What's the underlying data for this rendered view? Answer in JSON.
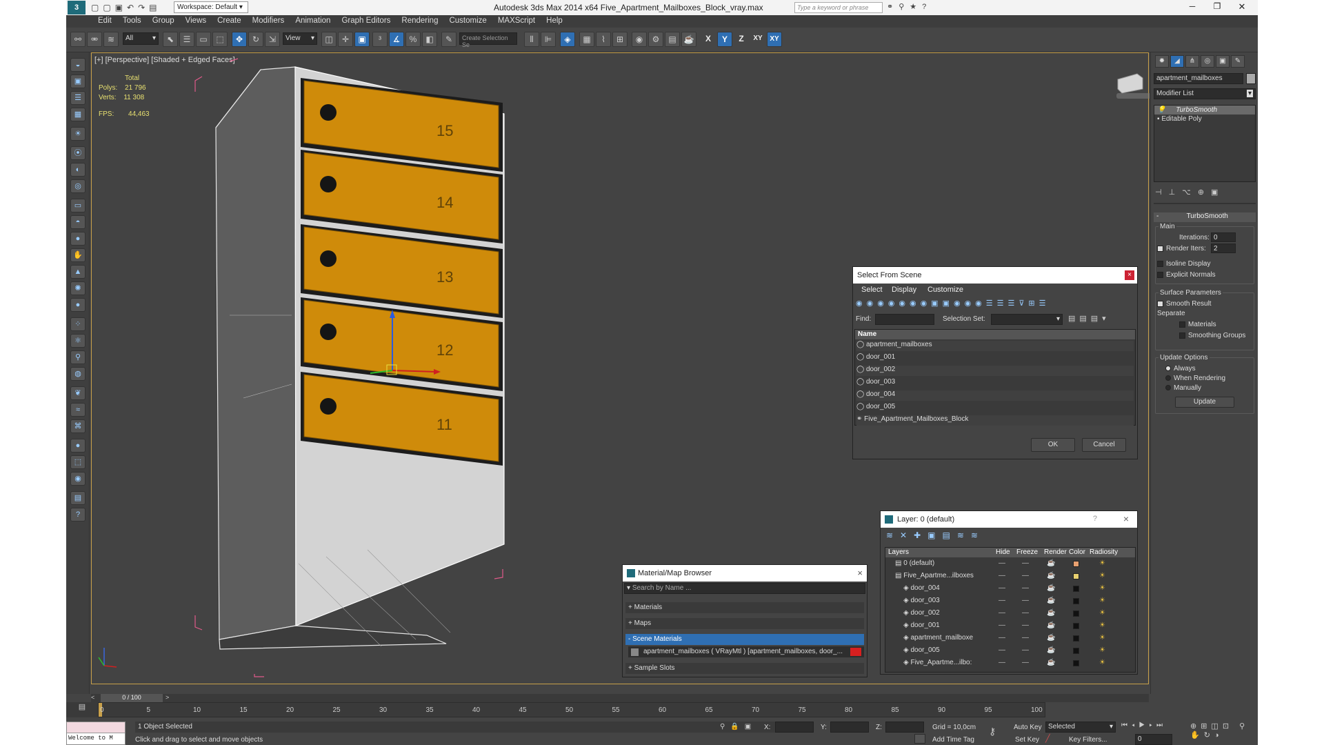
{
  "window": {
    "title": "Autodesk 3ds Max  2014 x64      Five_Apartment_Mailboxes_Block_vray.max",
    "workspace": "Workspace: Default",
    "search_placeholder": "Type a keyword or phrase"
  },
  "menu": [
    "Edit",
    "Tools",
    "Group",
    "Views",
    "Create",
    "Modifiers",
    "Animation",
    "Graph Editors",
    "Rendering",
    "Customize",
    "MAXScript",
    "Help"
  ],
  "toolbar": {
    "filter_value": "All",
    "refcoord_value": "View",
    "selection_set_placeholder": "Create Selection Se",
    "axes": [
      "X",
      "Y",
      "Z",
      "XY",
      "XY"
    ]
  },
  "viewport": {
    "label": "[+] [Perspective] [Shaded + Edged Faces]",
    "stats": {
      "total_label": "Total",
      "polys_label": "Polys:",
      "polys": "21 796",
      "verts_label": "Verts:",
      "verts": "11 308",
      "fps_label": "FPS:",
      "fps": "44,463"
    },
    "drawer_labels": [
      "15",
      "14",
      "13",
      "12",
      "11"
    ],
    "colors": {
      "drawer": "#cf8b0a",
      "drawer_edge": "#1c1c1c",
      "frame": "#dcdcdc",
      "selection": "#e05a8a"
    }
  },
  "command_panel": {
    "object_name": "apartment_mailboxes",
    "modifier_list_label": "Modifier List",
    "stack": [
      "TurboSmooth",
      "Editable Poly"
    ],
    "rollout_title": "TurboSmooth",
    "main_label": "Main",
    "iterations_label": "Iterations:",
    "iterations": "0",
    "render_iters_label": "Render Iters:",
    "render_iters": "2",
    "isoline": "Isoline Display",
    "explicit_normals": "Explicit Normals",
    "surface_params": "Surface Parameters",
    "smooth_result": "Smooth Result",
    "separate": "Separate",
    "materials": "Materials",
    "smoothing_groups": "Smoothing Groups",
    "update_options": "Update Options",
    "always": "Always",
    "when_rendering": "When Rendering",
    "manually": "Manually",
    "update_button": "Update"
  },
  "select_from_scene": {
    "title": "Select From Scene",
    "menu": [
      "Select",
      "Display",
      "Customize"
    ],
    "find_label": "Find:",
    "selection_set_label": "Selection Set:",
    "column_name": "Name",
    "items": [
      "apartment_mailboxes",
      "door_001",
      "door_002",
      "door_003",
      "door_004",
      "door_005",
      "Five_Apartment_Mailboxes_Block"
    ],
    "ok": "OK",
    "cancel": "Cancel"
  },
  "material_browser": {
    "title": "Material/Map Browser",
    "search_placeholder": "Search by Name ...",
    "sections": [
      "+ Materials",
      "+ Maps",
      "- Scene Materials",
      "+ Sample Slots"
    ],
    "scene_material": "apartment_mailboxes  ( VRayMtl ) [apartment_mailboxes, door_..."
  },
  "layer_dialog": {
    "title": "Layer: 0 (default)",
    "help": "?",
    "columns": [
      "Layers",
      "Hide",
      "Freeze",
      "Render",
      "Color",
      "Radiosity"
    ],
    "rows": [
      {
        "name": "0 (default)",
        "indent": 0,
        "color": "#e8a070"
      },
      {
        "name": "Five_Apartme...ilboxes",
        "indent": 0,
        "color": "#e8d070"
      },
      {
        "name": "door_004",
        "indent": 1,
        "color": "#111111"
      },
      {
        "name": "door_003",
        "indent": 1,
        "color": "#111111"
      },
      {
        "name": "door_002",
        "indent": 1,
        "color": "#111111"
      },
      {
        "name": "door_001",
        "indent": 1,
        "color": "#111111"
      },
      {
        "name": "apartment_mailboxe",
        "indent": 1,
        "color": "#111111"
      },
      {
        "name": "door_005",
        "indent": 1,
        "color": "#111111"
      },
      {
        "name": "Five_Apartme...ilbo:",
        "indent": 1,
        "color": "#111111"
      }
    ]
  },
  "timeline": {
    "frame_display": "0 / 100",
    "ticks": [
      "0",
      "5",
      "10",
      "15",
      "20",
      "25",
      "30",
      "35",
      "40",
      "45",
      "50",
      "55",
      "60",
      "65",
      "70",
      "75",
      "80",
      "85",
      "90",
      "95",
      "100"
    ]
  },
  "status": {
    "selection": "1 Object Selected",
    "prompt": "Click and drag to select and move objects",
    "listener": "Welcome to M",
    "x_label": "X:",
    "y_label": "Y:",
    "z_label": "Z:",
    "grid": "Grid = 10,0cm",
    "add_time_tag": "Add Time Tag",
    "auto_key": "Auto Key",
    "selected_value": "Selected",
    "set_key": "Set Key",
    "key_filters": "Key Filters...",
    "frame": "0"
  }
}
